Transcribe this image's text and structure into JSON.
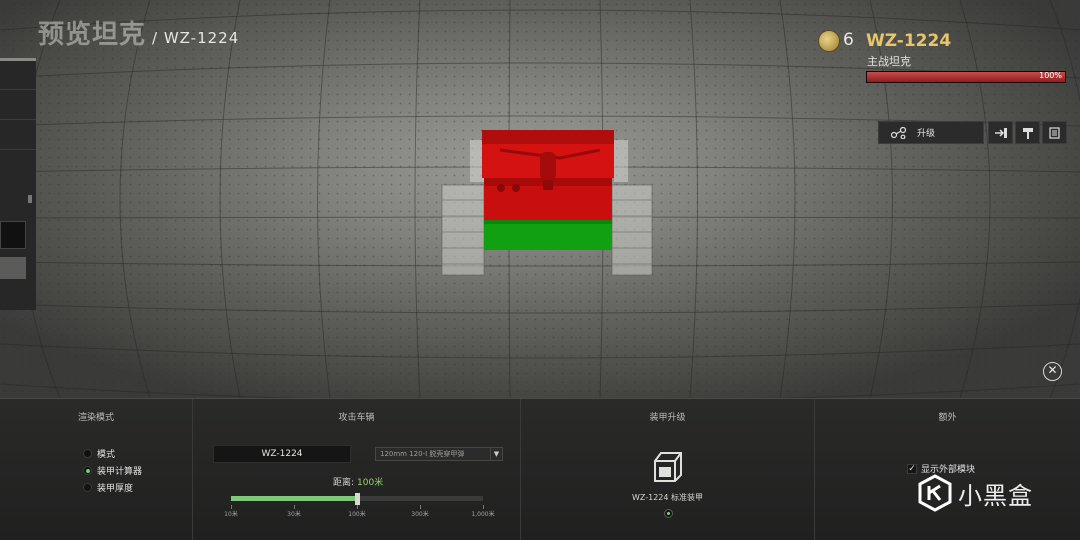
{
  "header": {
    "title": "预览坦克",
    "subtitle": "/ WZ-1224"
  },
  "tank": {
    "tier": "6",
    "name": "WZ-1224",
    "class": "主战坦克",
    "hp_label": "100%",
    "hp_fraction": 1.0
  },
  "actions": {
    "upgrade_label": "升级"
  },
  "icons": {
    "tier": "rank-medal-icon",
    "upgrade": "upgrade-nodes-icon",
    "exit": "exit-arrow-icon",
    "hammer": "hammer-icon",
    "notes": "notes-icon",
    "close": "close-icon",
    "armor": "armor-plate-icon"
  },
  "panels": {
    "render_mode": {
      "title": "渲染模式",
      "options": [
        {
          "label": "模式",
          "selected": false
        },
        {
          "label": "装甲计算器",
          "selected": true
        },
        {
          "label": "装甲厚度",
          "selected": false
        }
      ]
    },
    "attacker": {
      "title": "攻击车辆",
      "vehicle": "WZ-1224",
      "ammo": "120mm 120-I 脱壳穿甲弹",
      "distance_label": "距离:",
      "distance_value": "100米",
      "slider_fraction": 0.5,
      "scale": [
        "10米",
        "30米",
        "100米",
        "300米",
        "1,000米"
      ]
    },
    "armor_upgrade": {
      "title": "装甲升级",
      "item": "WZ-1224 标准装甲"
    },
    "extra": {
      "title": "额外",
      "checkbox_label": "显示外部模块",
      "checked": true
    }
  },
  "watermark": {
    "text": "小黑盒"
  },
  "colors": {
    "accent_gold": "#e8c56a",
    "hp_red": "#b23434",
    "slider_green": "#7fc87a",
    "armor_red": "#d01010",
    "armor_green": "#12a012"
  }
}
